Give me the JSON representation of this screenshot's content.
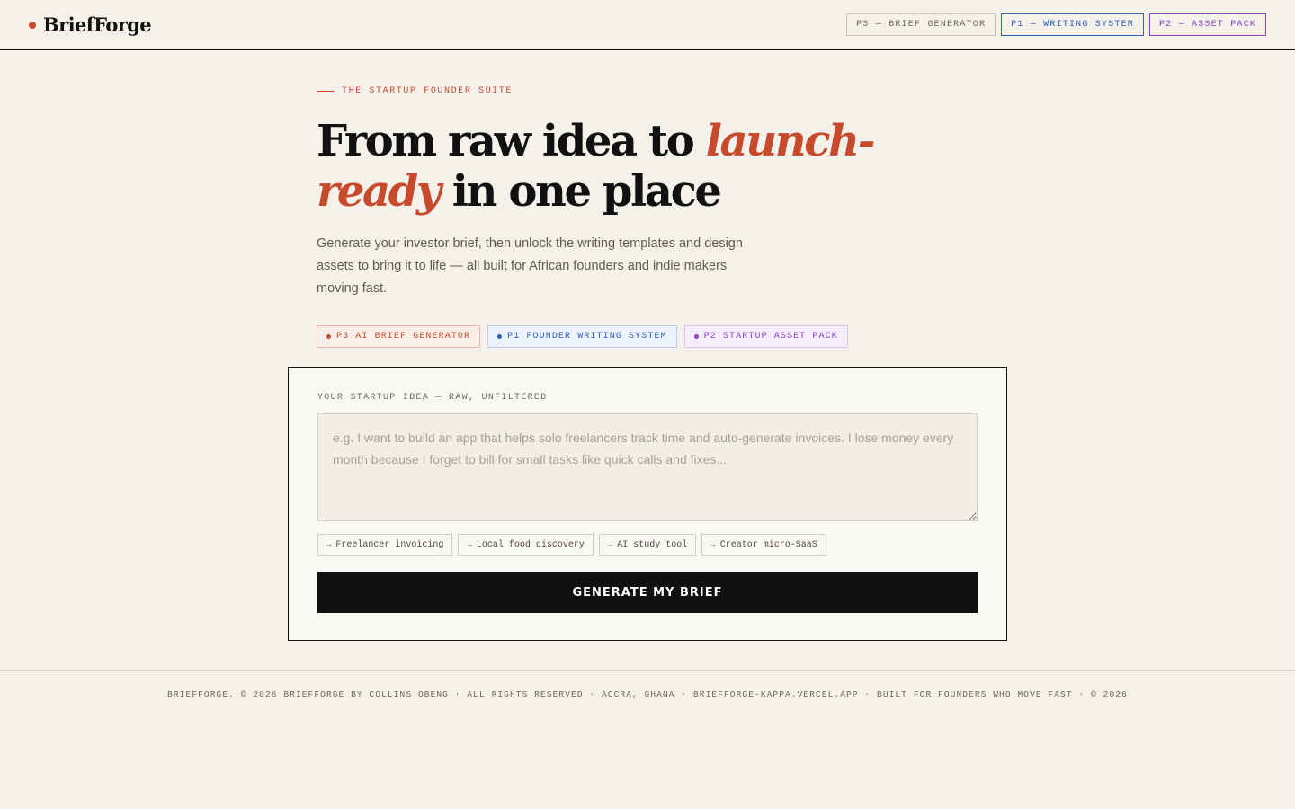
{
  "brand": {
    "name": "BriefForge",
    "dot_color": "#c84a2c"
  },
  "nav": [
    {
      "label": "P3 — BRIEF GENERATOR",
      "color": "#6b665e"
    },
    {
      "label": "P1 — WRITING SYSTEM",
      "color": "#2e5fb8"
    },
    {
      "label": "P2 — ASSET PACK",
      "color": "#8a44c4"
    }
  ],
  "hero": {
    "eyebrow": "THE STARTUP FOUNDER SUITE",
    "headline_before": "From raw idea to ",
    "headline_accent": "launch-ready",
    "headline_after": " in one place",
    "lede": "Generate your investor brief, then unlock the writing templates and design assets to bring it to life — all built for African founders and indie makers moving fast.",
    "tags": [
      {
        "label": "P3 AI BRIEF GENERATOR",
        "color": "#c84a2c"
      },
      {
        "label": "P1 FOUNDER WRITING SYSTEM",
        "color": "#2e5fb8"
      },
      {
        "label": "P2 STARTUP ASSET PACK",
        "color": "#8a44c4"
      }
    ]
  },
  "form": {
    "label": "YOUR STARTUP IDEA — RAW, UNFILTERED",
    "value": "",
    "placeholder": "e.g. I want to build an app that helps solo freelancers track time and auto-generate invoices. I lose money every month because I forget to bill for small tasks like quick calls and fixes...",
    "chips": [
      {
        "arrow": "→",
        "label": "Freelancer invoicing"
      },
      {
        "arrow": "→",
        "label": "Local food discovery"
      },
      {
        "arrow": "→",
        "label": "AI study tool"
      },
      {
        "arrow": "→",
        "label": "Creator micro-SaaS"
      }
    ],
    "submit_label": "GENERATE MY BRIEF"
  },
  "footer": {
    "text": "BRIEFFORGE. © 2026 BRIEFFORGE BY COLLINS OBENG · ALL RIGHTS RESERVED · ACCRA, GHANA · BRIEFFORGE-KAPPA.VERCEL.APP · BUILT FOR FOUNDERS WHO MOVE FAST · © 2026"
  },
  "colors": {
    "accent": "#c84a2c",
    "blue": "#2e5fb8",
    "purple": "#8a44c4",
    "background": "#f4f1eb"
  }
}
